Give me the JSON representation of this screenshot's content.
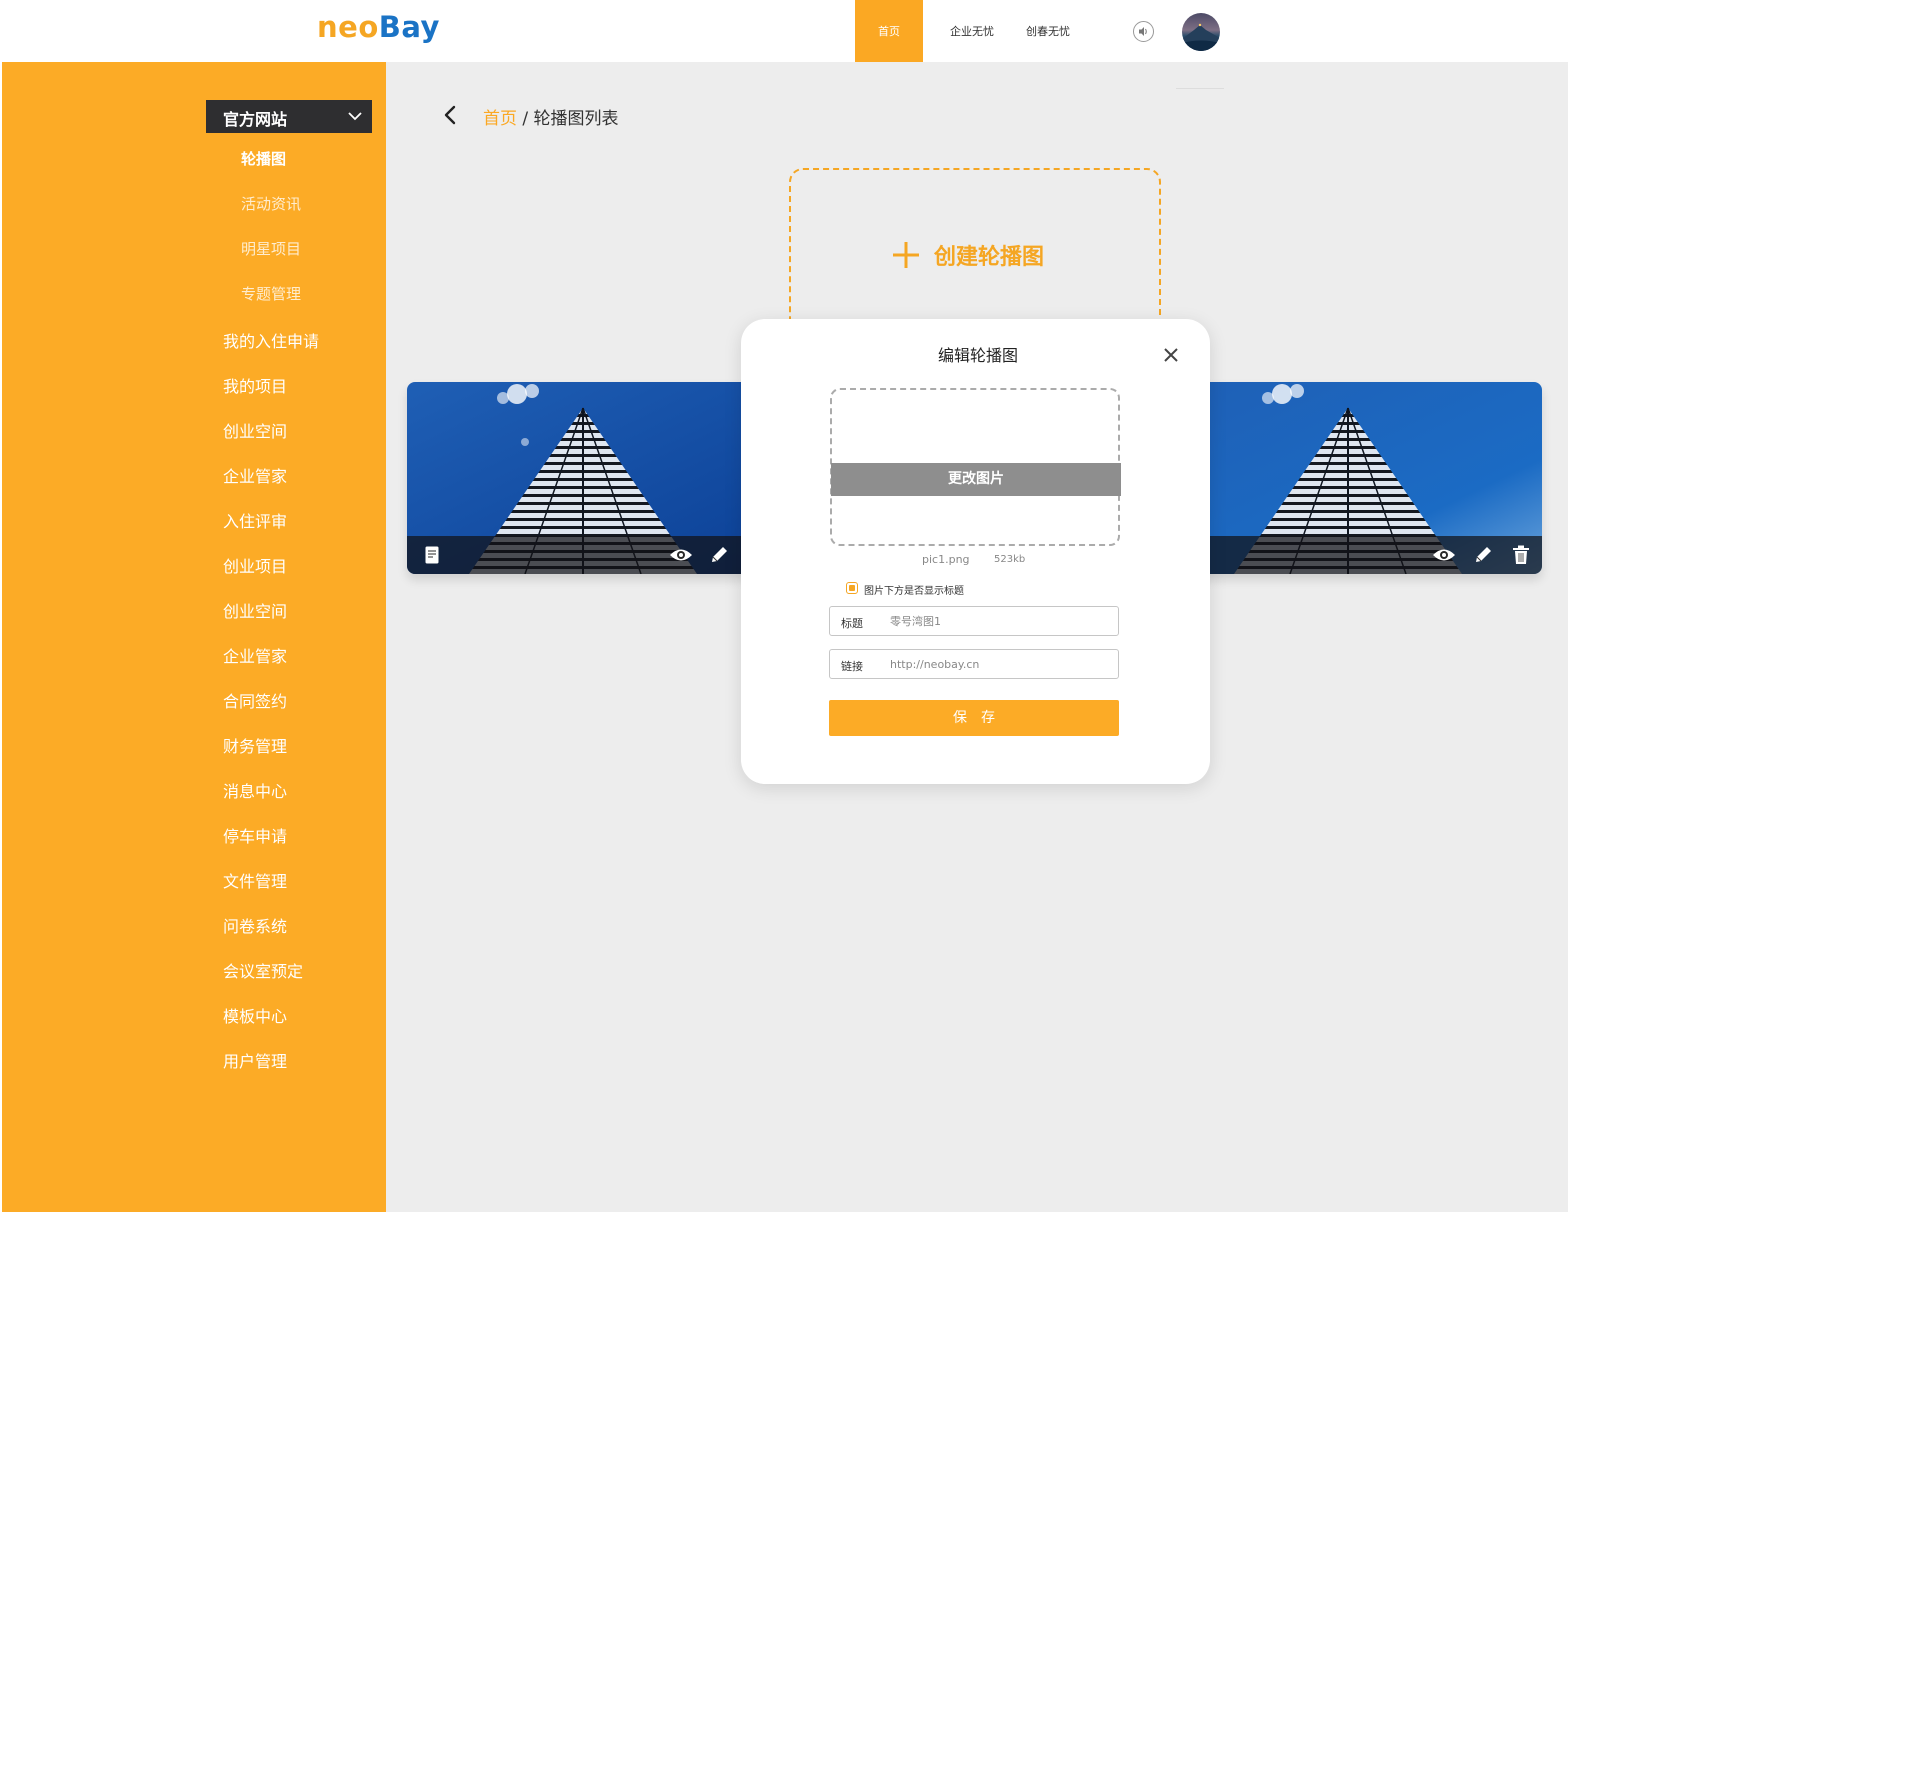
{
  "brand": {
    "logo_part1": "neo",
    "logo_part2": "Bay"
  },
  "nav": {
    "home": "首页",
    "enterprise": "企业无忧",
    "chuangchun": "创春无忧"
  },
  "sidebar": {
    "section_title": "官方网站",
    "sub_items": [
      "轮播图",
      "活动资讯",
      "明星项目",
      "专题管理"
    ],
    "items": [
      "我的入住申请",
      "我的项目",
      "创业空间",
      "企业管家",
      "入住评审",
      "创业项目",
      "创业空间",
      "企业管家",
      "合同签约",
      "财务管理",
      "消息中心",
      "停车申请",
      "文件管理",
      "问卷系统",
      "会议室预定",
      "模板中心",
      "用户管理"
    ]
  },
  "breadcrumb": {
    "home": "首页",
    "separator": "/",
    "current": "轮播图列表"
  },
  "create_label": "创建轮播图",
  "modal": {
    "title": "编辑轮播图",
    "change_image": "更改图片",
    "file_name": "pic1.png",
    "file_size": "523kb",
    "show_title_label": "图片下方是否显示标题",
    "show_title_checked": true,
    "title_label": "标题",
    "title_value": "零号湾图1",
    "link_label": "链接",
    "link_value": "http://neobay.cn",
    "save_label": "保　存"
  },
  "colors": {
    "accent": "#fcab26",
    "logo_blue": "#1a73c5",
    "section_dark": "#2e2e30"
  }
}
